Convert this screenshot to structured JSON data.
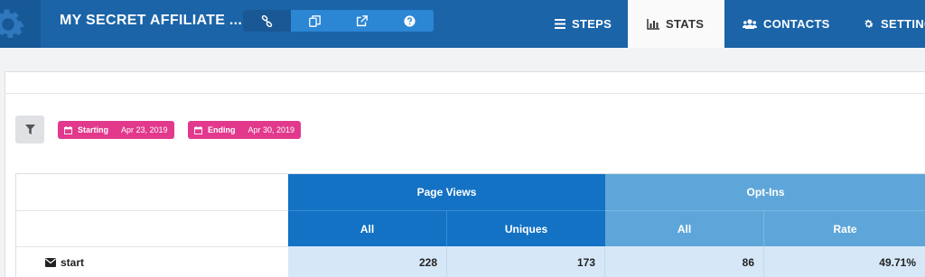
{
  "header": {
    "funnel_title": "MY SECRET AFFILIATE ...",
    "brand_color": "#1b64a8",
    "toolbar_icons": [
      "link-icon",
      "copy-icon",
      "external-link-icon",
      "help-icon"
    ],
    "nav_tabs": [
      {
        "label": "STEPS",
        "icon": "list-icon"
      },
      {
        "label": "STATS",
        "icon": "bar-chart-icon",
        "active": true
      },
      {
        "label": "CONTACTS",
        "icon": "users-icon"
      },
      {
        "label": "SETTING",
        "icon": "gear-icon"
      }
    ]
  },
  "filters": {
    "filter_icon": "filter-icon",
    "starting_label": "Starting",
    "starting_value": "Apr 23, 2019",
    "ending_label": "Ending",
    "ending_value": "Apr 30, 2019",
    "pill_color": "#e2398d"
  },
  "stats_table": {
    "groups": [
      {
        "label": "Page Views",
        "color": "#1372c4",
        "columns": [
          "All",
          "Uniques"
        ]
      },
      {
        "label": "Opt-Ins",
        "color": "#5ea6d9",
        "columns": [
          "All",
          "Rate"
        ]
      }
    ],
    "rows": [
      {
        "step": "start",
        "icon": "envelope-icon",
        "values": [
          "228",
          "173",
          "86",
          "49.71%"
        ]
      }
    ]
  }
}
